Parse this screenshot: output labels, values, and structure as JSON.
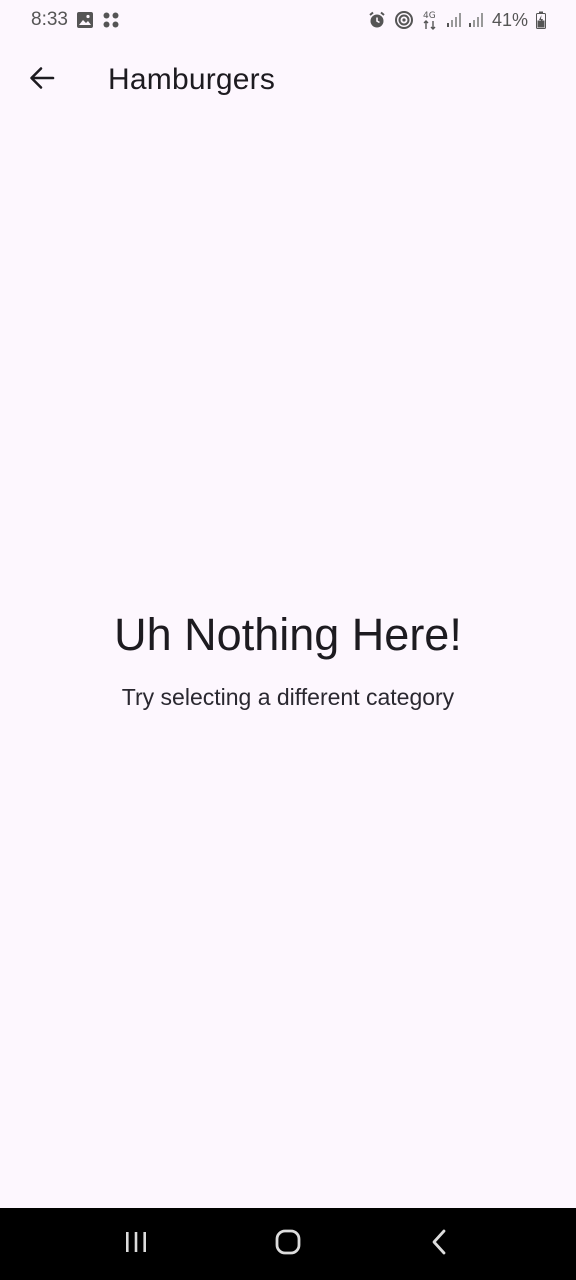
{
  "status_bar": {
    "time": "8:33",
    "battery_percent": "41%",
    "network_label": "4G",
    "icons": [
      "image-icon",
      "dots-grid-icon",
      "alarm-icon",
      "hotspot-icon",
      "network-4g-icon",
      "signal-icon",
      "signal-icon",
      "battery-icon"
    ]
  },
  "app_bar": {
    "title": "Hamburgers",
    "back_icon": "arrow-left-icon"
  },
  "empty_state": {
    "title": "Uh Nothing Here!",
    "subtitle": "Try selecting a different category"
  },
  "nav_bar": {
    "icons": [
      "recent-apps-icon",
      "home-icon",
      "back-nav-icon"
    ]
  },
  "colors": {
    "background": "#fdf7fe",
    "text": "#1d1b20",
    "nav_background": "#000000"
  }
}
